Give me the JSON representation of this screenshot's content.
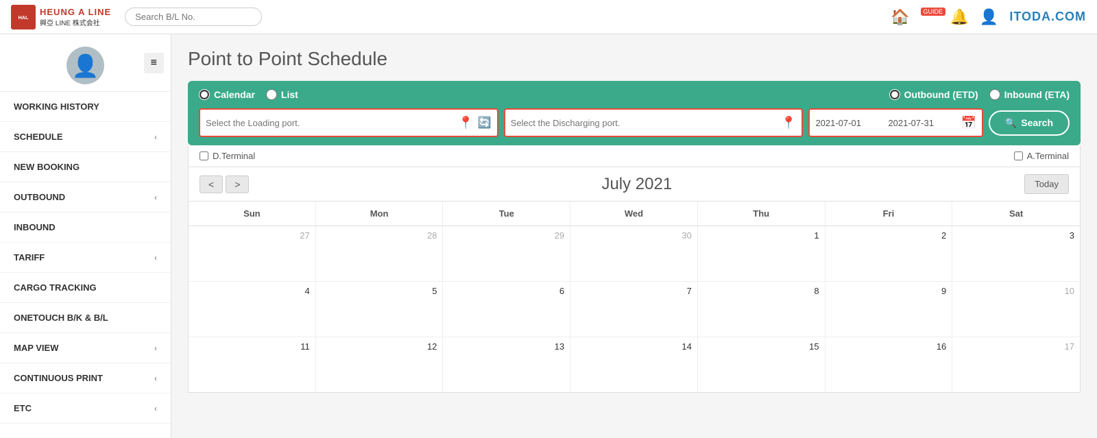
{
  "navbar": {
    "logo_text_line1": "HEUNG A LINE",
    "logo_text_line2": "興亞 LINE 株式会社",
    "search_placeholder": "Search B/L No.",
    "guide_badge": "GUIDE",
    "watermark": "ITODA.COM"
  },
  "sidebar": {
    "avatar_alt": "user avatar",
    "menu_toggle": "≡",
    "items": [
      {
        "label": "WORKING HISTORY",
        "has_chevron": false
      },
      {
        "label": "SCHEDULE",
        "has_chevron": true
      },
      {
        "label": "NEW BOOKING",
        "has_chevron": false
      },
      {
        "label": "OUTBOUND",
        "has_chevron": true
      },
      {
        "label": "INBOUND",
        "has_chevron": false
      },
      {
        "label": "TARIFF",
        "has_chevron": true
      },
      {
        "label": "CARGO TRACKING",
        "has_chevron": false
      },
      {
        "label": "ONETOUCH B/K & B/L",
        "has_chevron": false
      },
      {
        "label": "MAP VIEW",
        "has_chevron": true
      },
      {
        "label": "CONTINUOUS PRINT",
        "has_chevron": true
      },
      {
        "label": "ETC",
        "has_chevron": true
      }
    ]
  },
  "content": {
    "page_title": "Point to Point Schedule",
    "filter": {
      "radio_calendar_label": "Calendar",
      "radio_list_label": "List",
      "radio_outbound_label": "Outbound (ETD)",
      "radio_inbound_label": "Inbound (ETA)",
      "loading_port_placeholder": "Select the Loading port.",
      "discharging_port_placeholder": "Select the Discharging port.",
      "date_from": "2021-07-01",
      "date_to": "2021-07-31",
      "search_btn_label": "Search",
      "d_terminal_label": "D.Terminal",
      "a_terminal_label": "A.Terminal"
    },
    "calendar": {
      "month_title": "July 2021",
      "prev_btn": "<",
      "next_btn": ">",
      "today_btn": "Today",
      "day_headers": [
        "Sun",
        "Mon",
        "Tue",
        "Wed",
        "Thu",
        "Fri",
        "Sat"
      ],
      "weeks": [
        [
          {
            "num": "27",
            "current": false
          },
          {
            "num": "28",
            "current": false
          },
          {
            "num": "29",
            "current": false
          },
          {
            "num": "30",
            "current": false
          },
          {
            "num": "1",
            "current": true
          },
          {
            "num": "2",
            "current": true
          },
          {
            "num": "3",
            "current": true
          }
        ],
        [
          {
            "num": "4",
            "current": true
          },
          {
            "num": "5",
            "current": true
          },
          {
            "num": "6",
            "current": true
          },
          {
            "num": "7",
            "current": true
          },
          {
            "num": "8",
            "current": true
          },
          {
            "num": "9",
            "current": true
          },
          {
            "num": "10",
            "current": true
          }
        ],
        [
          {
            "num": "11",
            "current": true
          },
          {
            "num": "12",
            "current": true
          },
          {
            "num": "13",
            "current": true
          },
          {
            "num": "14",
            "current": true
          },
          {
            "num": "15",
            "current": true
          },
          {
            "num": "16",
            "current": true
          },
          {
            "num": "17",
            "current": true
          }
        ]
      ]
    }
  },
  "colors": {
    "teal": "#3aaa8a",
    "red_border": "#e74c3c",
    "sidebar_bg": "#ffffff"
  }
}
